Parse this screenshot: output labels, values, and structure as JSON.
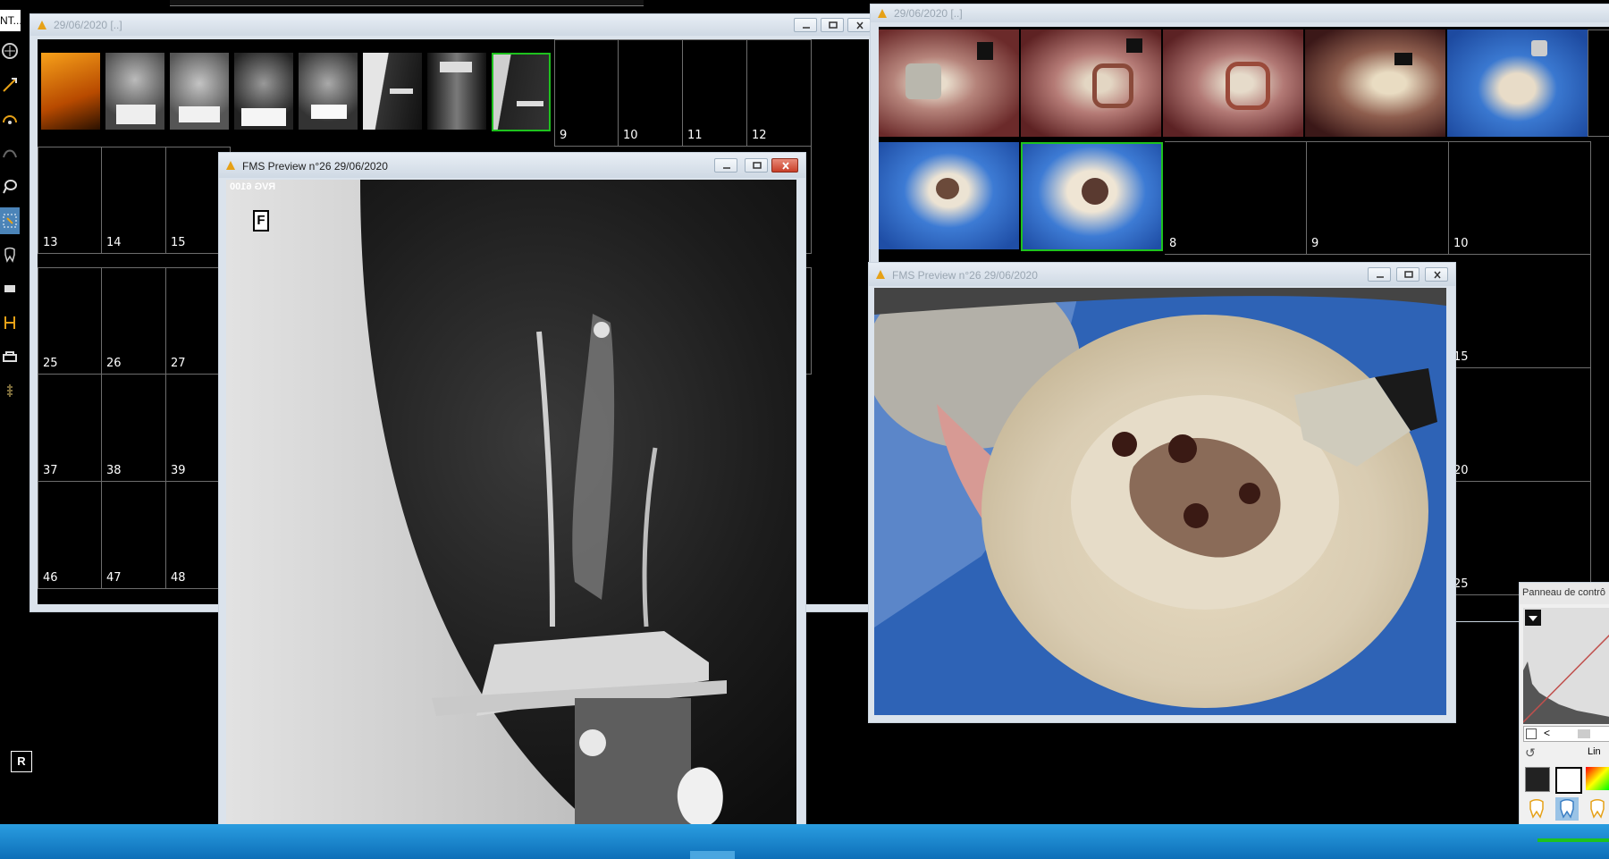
{
  "left_toolbar": {
    "top_label": "NT...",
    "tools": [
      "grid-icon",
      "pen-arrow-icon",
      "gauge-icon",
      "curve-icon",
      "lasso-icon",
      "tooth-select-icon",
      "tooth-icon",
      "crown-icon",
      "bracket-icon",
      "xray-sensor-icon",
      "implant-icon"
    ]
  },
  "xray_gallery_window": {
    "title": "29/06/2020 [..]",
    "cell_numbers_row1": [
      "9",
      "10",
      "11",
      "12"
    ],
    "cell_numbers_row2": [
      "13",
      "14",
      "15"
    ],
    "cell_numbers_row3": [
      "25",
      "26",
      "27"
    ],
    "cell_numbers_row4": [
      "37",
      "38",
      "39"
    ],
    "cell_numbers_row5": [
      "46",
      "47",
      "48"
    ]
  },
  "photo_gallery_window": {
    "title": "29/06/2020 [..]",
    "cell_numbers_row2": [
      "8",
      "9",
      "10"
    ],
    "cell_numbers_side": [
      "15",
      "20",
      "25"
    ]
  },
  "xray_preview_window": {
    "title": "FMS Preview n°26 29/06/2020",
    "sensor_label": "RVG 6100",
    "marker_letter": "F"
  },
  "photo_preview_window": {
    "title": "FMS Preview n°26 29/06/2020"
  },
  "control_panel": {
    "title": "Panneau de contrô",
    "lin_label": "Lin",
    "arrow_left": "<"
  },
  "badge_r": "R",
  "colors": {
    "accent_selected": "#1ec21e",
    "taskbar": "#1a86cf",
    "title_close": "#c9402a"
  }
}
